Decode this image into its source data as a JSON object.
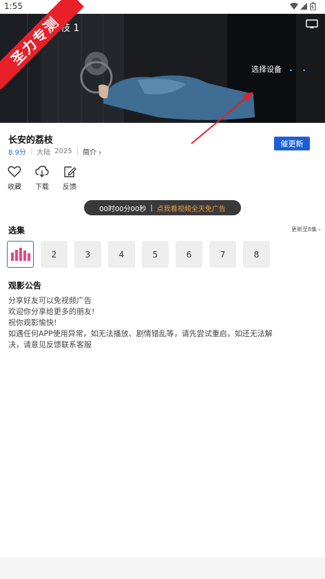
{
  "status_bar": {
    "time": "1:55"
  },
  "player": {
    "title": "的荔枝 1",
    "select_device_label": "选择设备",
    "dots": "• •"
  },
  "watermark": {
    "text": "圣力专测"
  },
  "drama": {
    "title": "长安的荔枝",
    "score": "8.9分",
    "region": "大陆",
    "year": "2025",
    "intro_label": "简介 ›",
    "remind_button": "催更新"
  },
  "actions": [
    {
      "label": "收藏",
      "icon": "heart-icon"
    },
    {
      "label": "下载",
      "icon": "download-icon"
    },
    {
      "label": "反馈",
      "icon": "feedback-icon"
    }
  ],
  "ad_timer": {
    "time": "00时00分00秒",
    "separator": "|",
    "ad_text": "点我看视频全天免广告"
  },
  "episodes": {
    "title": "选集",
    "more_label": "更新至8集 ›",
    "items": [
      "",
      "2",
      "3",
      "4",
      "5",
      "6",
      "7",
      "8"
    ]
  },
  "notice": {
    "title": "观影公告",
    "lines": [
      "分享好友可以免视频广告",
      "欢迎你分享给更多的朋友!",
      "祝你观影愉快!",
      "如遇任何APP使用异常，如无法播放、剧情错乱等，请先尝试重启，如还无法解",
      "决，请意见反馈联系客服"
    ]
  },
  "colors": {
    "accent": "#1a5fd6",
    "score": "#2a6bd6",
    "ad_text": "#f39a3a",
    "ribbon": "#e8202a",
    "arrow": "#e8202a",
    "playing_bars": "#e8458a"
  }
}
